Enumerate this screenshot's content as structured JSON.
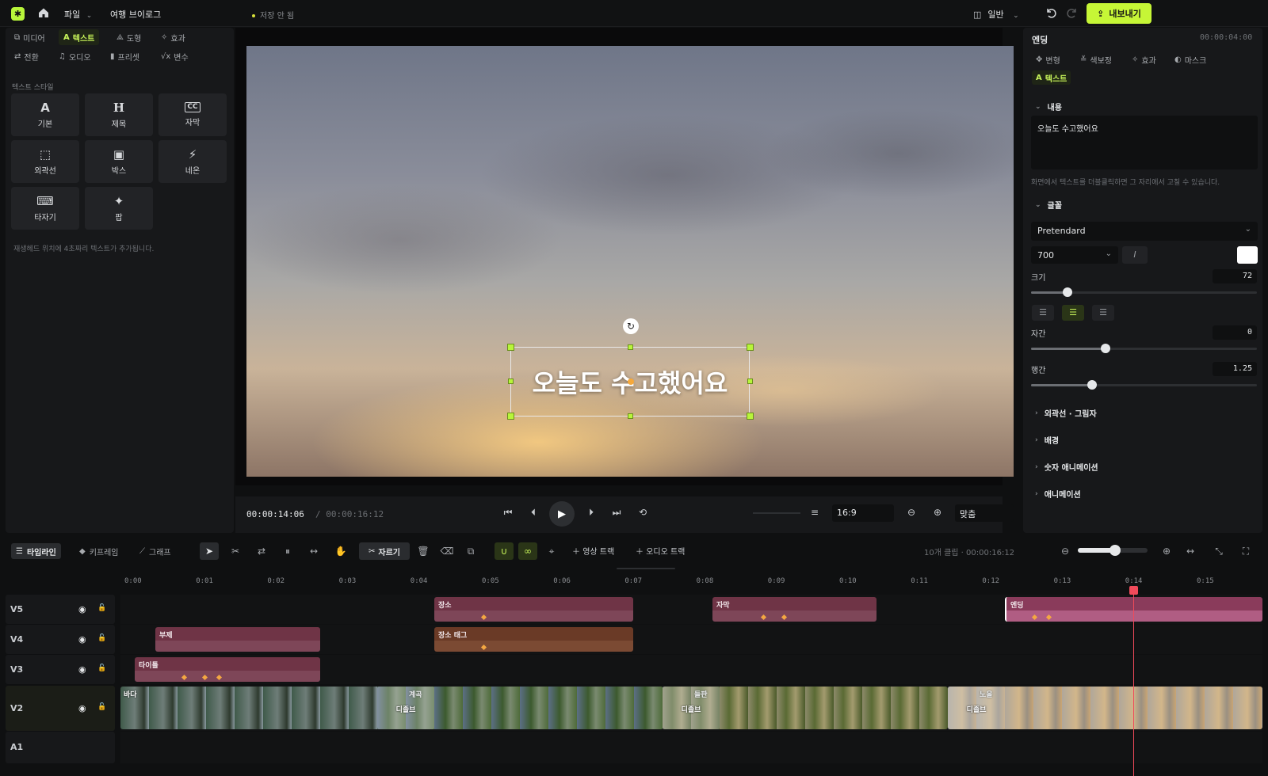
{
  "topbar": {
    "file_menu": "파일",
    "project_title": "여행 브이로그",
    "save_status": "저장 안 됨",
    "layout_mode": "일반",
    "export_label": "내보내기"
  },
  "left_panel": {
    "tabs": [
      {
        "label": "미디어",
        "icon": "media-icon"
      },
      {
        "label": "텍스트",
        "icon": "text-icon",
        "active": true
      },
      {
        "label": "도형",
        "icon": "shape-icon"
      },
      {
        "label": "효과",
        "icon": "effect-icon"
      },
      {
        "label": "전환",
        "icon": "transition-icon"
      },
      {
        "label": "오디오",
        "icon": "audio-icon"
      },
      {
        "label": "프리셋",
        "icon": "preset-icon"
      },
      {
        "label": "변수",
        "icon": "variable-icon"
      }
    ],
    "section_label": "텍스트 스타일",
    "styles": [
      {
        "glyph": "A",
        "label": "기본"
      },
      {
        "glyph": "H",
        "label": "제목"
      },
      {
        "glyph": "CC",
        "label": "자막"
      },
      {
        "glyph": "⬚",
        "label": "외곽선"
      },
      {
        "glyph": "▣",
        "label": "박스"
      },
      {
        "glyph": "⚡",
        "label": "네온"
      },
      {
        "glyph": "⌨",
        "label": "타자기"
      },
      {
        "glyph": "✦",
        "label": "팝"
      }
    ],
    "hint": "재생헤드 위치에 4초짜리 텍스트가 추가됩니다."
  },
  "preview": {
    "caption": "오늘도 수고했어요",
    "current_time": "00:00:14:06",
    "total_time": "/ 00:00:16:12",
    "aspect": "16:9",
    "zoom": "맞춤"
  },
  "right_panel": {
    "title": "엔딩",
    "time": "00:00:04:00",
    "tabs": [
      "변형",
      "색보정",
      "효과",
      "마스크",
      "텍스트"
    ],
    "content_section": "내용",
    "content_value": "오늘도 수고했어요",
    "content_hint": "화면에서 텍스트를 더블클릭하면 그 자리에서 고칠 수 있습니다.",
    "font_section": "글꼴",
    "font_family": "Pretendard",
    "font_weight": "700",
    "italic_label": "I",
    "size_label": "크기",
    "size_value": "72",
    "size_fraction": 0.16,
    "tracking_label": "자간",
    "tracking_value": "0",
    "tracking_fraction": 0.33,
    "leading_label": "행간",
    "leading_value": "1.25",
    "leading_fraction": 0.27,
    "collapsed_sections": [
      "외곽선 · 그림자",
      "배경",
      "숫자 애니메이션",
      "애니메이션"
    ]
  },
  "timeline": {
    "tabs": [
      "타임라인",
      "키프레임",
      "그래프"
    ],
    "split_label": "자르기",
    "add_video_track": "영상 트랙",
    "add_audio_track": "오디오 트랙",
    "info": "10개 클립 · 00:00:16:12",
    "zoom_fraction": 0.5,
    "ruler": [
      "0:00",
      "0:01",
      "0:02",
      "0:03",
      "0:04",
      "0:05",
      "0:06",
      "0:07",
      "0:08",
      "0:09",
      "0:10",
      "0:11",
      "0:12",
      "0:13",
      "0:14",
      "0:15"
    ],
    "tracks": [
      "V5",
      "V4",
      "V3",
      "V2",
      "A1"
    ],
    "clips": {
      "place": "장소",
      "subtitle_clip": "자막",
      "ending": "엔딩",
      "sub": "부제",
      "place_tag": "장소 태그",
      "title": "타이틀",
      "sea": "바다",
      "canyon": "계곡",
      "field": "들판",
      "sunset": "노을",
      "dissolve": "디졸브"
    },
    "playhead_time": "0:14"
  },
  "colors": {
    "accent": "#c6f636",
    "playhead": "#f04a5a",
    "keyframe": "#f3a742"
  }
}
